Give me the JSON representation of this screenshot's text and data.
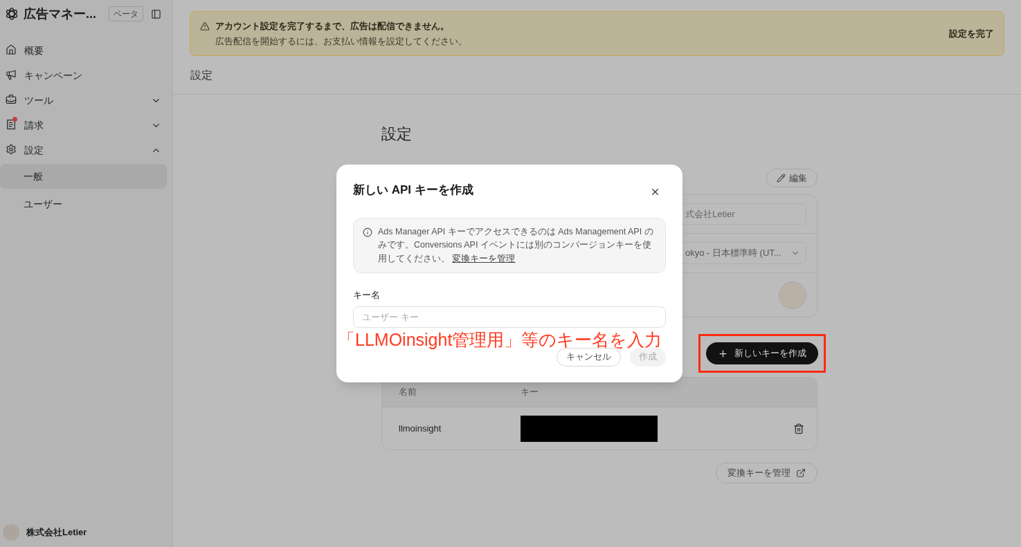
{
  "sidebar": {
    "title": "広告マネー...",
    "badge": "ベータ",
    "items": [
      {
        "label": "概要"
      },
      {
        "label": "キャンペーン"
      },
      {
        "label": "ツール",
        "expanded": false
      },
      {
        "label": "請求",
        "expanded": false,
        "notification": true
      },
      {
        "label": "設定",
        "expanded": true,
        "children": [
          {
            "label": "一般",
            "selected": true
          },
          {
            "label": "ユーザー",
            "selected": false
          }
        ]
      }
    ],
    "account": {
      "name": "株式会社Letier"
    }
  },
  "banner": {
    "title": "アカウント設定を完了するまで、広告は配信できません。",
    "message": "広告配信を開始するには、お支払い情報を設定してください。",
    "action": "設定を完了"
  },
  "page_header": "設定",
  "settings": {
    "title": "設定",
    "edit_button": "編集",
    "company_field": "式会社Letier",
    "timezone": "okyo - 日本標準時 (UT..."
  },
  "create_key_button": "新しいキーを作成",
  "keys_table": {
    "columns": [
      "名前",
      "キー"
    ],
    "rows": [
      {
        "name": "llmoinsight",
        "redacted": true
      }
    ]
  },
  "manage_button": "変換キーを管理",
  "dialog": {
    "title": "新しい API キーを作成",
    "info": {
      "text": "Ads Manager API キーでアクセスできるのは Ads Management API のみです。Conversions API イベントには別のコンバージョンキーを使用してください。",
      "link": "変換キーを管理"
    },
    "field": {
      "label": "キー名",
      "placeholder": "ユーザー キー"
    },
    "buttons": [
      {
        "label": "キャンセル",
        "disabled": false
      },
      {
        "label": "作成",
        "disabled": true
      }
    ]
  },
  "annotation": {
    "text": "「LLMOinsight管理用」等のキー名を入力"
  }
}
